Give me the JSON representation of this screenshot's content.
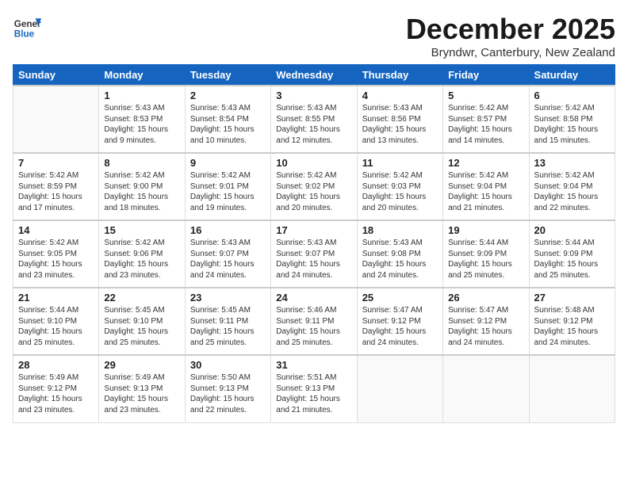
{
  "header": {
    "logo_line1": "General",
    "logo_line2": "Blue",
    "month": "December 2025",
    "location": "Bryndwr, Canterbury, New Zealand"
  },
  "weekdays": [
    "Sunday",
    "Monday",
    "Tuesday",
    "Wednesday",
    "Thursday",
    "Friday",
    "Saturday"
  ],
  "weeks": [
    [
      {
        "day": "",
        "info": ""
      },
      {
        "day": "1",
        "info": "Sunrise: 5:43 AM\nSunset: 8:53 PM\nDaylight: 15 hours\nand 9 minutes."
      },
      {
        "day": "2",
        "info": "Sunrise: 5:43 AM\nSunset: 8:54 PM\nDaylight: 15 hours\nand 10 minutes."
      },
      {
        "day": "3",
        "info": "Sunrise: 5:43 AM\nSunset: 8:55 PM\nDaylight: 15 hours\nand 12 minutes."
      },
      {
        "day": "4",
        "info": "Sunrise: 5:43 AM\nSunset: 8:56 PM\nDaylight: 15 hours\nand 13 minutes."
      },
      {
        "day": "5",
        "info": "Sunrise: 5:42 AM\nSunset: 8:57 PM\nDaylight: 15 hours\nand 14 minutes."
      },
      {
        "day": "6",
        "info": "Sunrise: 5:42 AM\nSunset: 8:58 PM\nDaylight: 15 hours\nand 15 minutes."
      }
    ],
    [
      {
        "day": "7",
        "info": "Sunrise: 5:42 AM\nSunset: 8:59 PM\nDaylight: 15 hours\nand 17 minutes."
      },
      {
        "day": "8",
        "info": "Sunrise: 5:42 AM\nSunset: 9:00 PM\nDaylight: 15 hours\nand 18 minutes."
      },
      {
        "day": "9",
        "info": "Sunrise: 5:42 AM\nSunset: 9:01 PM\nDaylight: 15 hours\nand 19 minutes."
      },
      {
        "day": "10",
        "info": "Sunrise: 5:42 AM\nSunset: 9:02 PM\nDaylight: 15 hours\nand 20 minutes."
      },
      {
        "day": "11",
        "info": "Sunrise: 5:42 AM\nSunset: 9:03 PM\nDaylight: 15 hours\nand 20 minutes."
      },
      {
        "day": "12",
        "info": "Sunrise: 5:42 AM\nSunset: 9:04 PM\nDaylight: 15 hours\nand 21 minutes."
      },
      {
        "day": "13",
        "info": "Sunrise: 5:42 AM\nSunset: 9:04 PM\nDaylight: 15 hours\nand 22 minutes."
      }
    ],
    [
      {
        "day": "14",
        "info": "Sunrise: 5:42 AM\nSunset: 9:05 PM\nDaylight: 15 hours\nand 23 minutes."
      },
      {
        "day": "15",
        "info": "Sunrise: 5:42 AM\nSunset: 9:06 PM\nDaylight: 15 hours\nand 23 minutes."
      },
      {
        "day": "16",
        "info": "Sunrise: 5:43 AM\nSunset: 9:07 PM\nDaylight: 15 hours\nand 24 minutes."
      },
      {
        "day": "17",
        "info": "Sunrise: 5:43 AM\nSunset: 9:07 PM\nDaylight: 15 hours\nand 24 minutes."
      },
      {
        "day": "18",
        "info": "Sunrise: 5:43 AM\nSunset: 9:08 PM\nDaylight: 15 hours\nand 24 minutes."
      },
      {
        "day": "19",
        "info": "Sunrise: 5:44 AM\nSunset: 9:09 PM\nDaylight: 15 hours\nand 25 minutes."
      },
      {
        "day": "20",
        "info": "Sunrise: 5:44 AM\nSunset: 9:09 PM\nDaylight: 15 hours\nand 25 minutes."
      }
    ],
    [
      {
        "day": "21",
        "info": "Sunrise: 5:44 AM\nSunset: 9:10 PM\nDaylight: 15 hours\nand 25 minutes."
      },
      {
        "day": "22",
        "info": "Sunrise: 5:45 AM\nSunset: 9:10 PM\nDaylight: 15 hours\nand 25 minutes."
      },
      {
        "day": "23",
        "info": "Sunrise: 5:45 AM\nSunset: 9:11 PM\nDaylight: 15 hours\nand 25 minutes."
      },
      {
        "day": "24",
        "info": "Sunrise: 5:46 AM\nSunset: 9:11 PM\nDaylight: 15 hours\nand 25 minutes."
      },
      {
        "day": "25",
        "info": "Sunrise: 5:47 AM\nSunset: 9:12 PM\nDaylight: 15 hours\nand 24 minutes."
      },
      {
        "day": "26",
        "info": "Sunrise: 5:47 AM\nSunset: 9:12 PM\nDaylight: 15 hours\nand 24 minutes."
      },
      {
        "day": "27",
        "info": "Sunrise: 5:48 AM\nSunset: 9:12 PM\nDaylight: 15 hours\nand 24 minutes."
      }
    ],
    [
      {
        "day": "28",
        "info": "Sunrise: 5:49 AM\nSunset: 9:12 PM\nDaylight: 15 hours\nand 23 minutes."
      },
      {
        "day": "29",
        "info": "Sunrise: 5:49 AM\nSunset: 9:13 PM\nDaylight: 15 hours\nand 23 minutes."
      },
      {
        "day": "30",
        "info": "Sunrise: 5:50 AM\nSunset: 9:13 PM\nDaylight: 15 hours\nand 22 minutes."
      },
      {
        "day": "31",
        "info": "Sunrise: 5:51 AM\nSunset: 9:13 PM\nDaylight: 15 hours\nand 21 minutes."
      },
      {
        "day": "",
        "info": ""
      },
      {
        "day": "",
        "info": ""
      },
      {
        "day": "",
        "info": ""
      }
    ]
  ]
}
